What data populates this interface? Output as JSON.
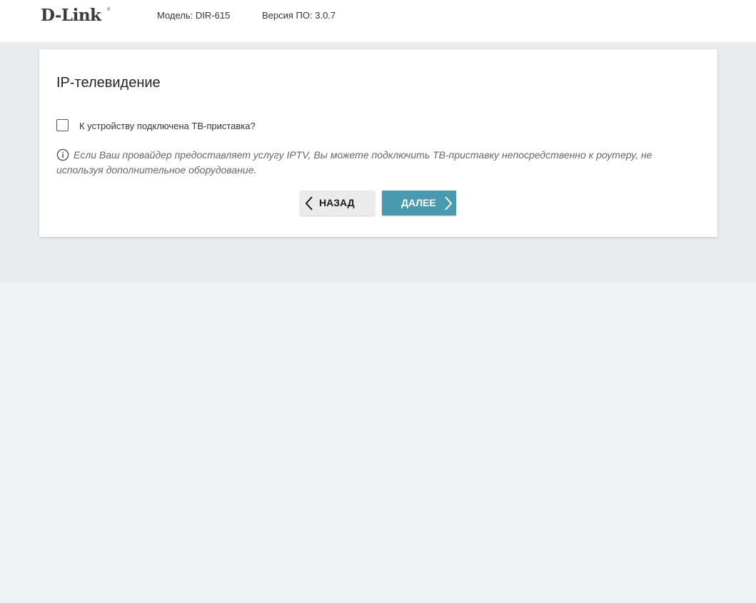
{
  "header": {
    "logo_text": "D-Link",
    "logo_mark": "®",
    "model": "Модель: DIR-615",
    "firmware": "Версия ПО: 3.0.7"
  },
  "card": {
    "title": "IP-телевидение",
    "checkbox_label": "К устройству подключена ТВ-приставка?",
    "checkbox_checked": false,
    "info_icon": "info-circle-icon",
    "info_text": "Если Ваш провайдер предоставляет услугу IPTV, Вы можете подключить ТВ-приставку непосредственно к роутеру, не используя дополнительное оборудование."
  },
  "buttons": {
    "back_label": "НАЗАД",
    "back_icon": "chevron-left-icon",
    "next_label": "ДАЛЕЕ",
    "next_icon": "chevron-right-icon"
  },
  "colors": {
    "background": "#eff2f5",
    "next_button": "#4a9aaf",
    "back_button": "#ebebeb"
  }
}
